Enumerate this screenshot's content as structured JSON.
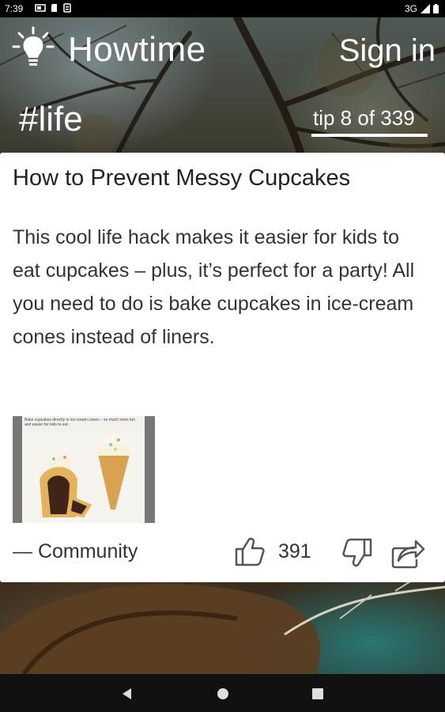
{
  "status_bar": {
    "time": "7:39",
    "network": "3G",
    "icons": [
      "cast-icon",
      "sd-card-icon",
      "sync-icon",
      "signal-icon",
      "battery-icon"
    ]
  },
  "header": {
    "app_title": "Howtime",
    "sign_in_label": "Sign in",
    "hashtag": "#life",
    "tip_counter": "tip 8 of 339",
    "tip_progress": 0.0236
  },
  "card": {
    "title": "How to Prevent Messy Cupcakes",
    "body": "This cool life hack makes it easier for kids to eat cupcakes – plus, it’s perfect for a party! All you need to do is bake cupcakes in ice-cream cones instead of liners.",
    "image_caption": "Bake cupcakes directly in ice-cream cones – so much more fun and easier for kids to eat.",
    "author": "— Community",
    "like_count": "391"
  },
  "colors": {
    "card_bg": "#ffffff",
    "text": "#333333",
    "header_text": "#ffffff",
    "navbar_bg": "#111111"
  }
}
